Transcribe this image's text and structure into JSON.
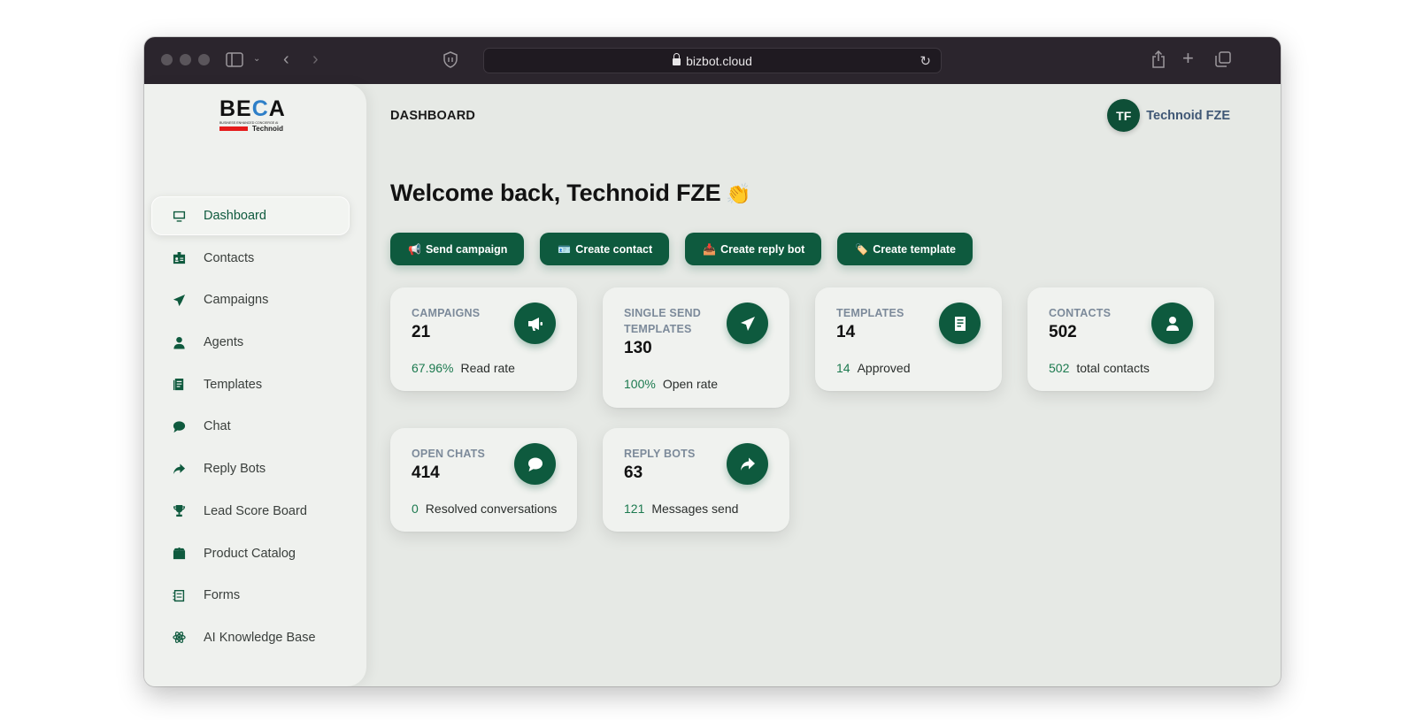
{
  "browser": {
    "url": "bizbot.cloud"
  },
  "logo": {
    "text_main": "BECA",
    "tagline": "BUSINESS ENHANCED CONCIERGE AI",
    "sub": "Technoid"
  },
  "sidebar": {
    "items": [
      {
        "label": "Dashboard",
        "icon": "monitor-icon",
        "active": true
      },
      {
        "label": "Contacts",
        "icon": "contact-card-icon"
      },
      {
        "label": "Campaigns",
        "icon": "paper-plane-icon"
      },
      {
        "label": "Agents",
        "icon": "user-icon"
      },
      {
        "label": "Templates",
        "icon": "document-icon"
      },
      {
        "label": "Chat",
        "icon": "chat-bubble-icon"
      },
      {
        "label": "Reply Bots",
        "icon": "share-arrow-icon"
      },
      {
        "label": "Lead Score Board",
        "icon": "trophy-icon"
      },
      {
        "label": "Product Catalog",
        "icon": "box-icon"
      },
      {
        "label": "Forms",
        "icon": "form-icon"
      },
      {
        "label": "AI Knowledge Base",
        "icon": "atom-icon"
      }
    ]
  },
  "header": {
    "title": "DASHBOARD",
    "user_initials": "TF",
    "user_name": "Technoid FZE"
  },
  "welcome": {
    "text": "Welcome back, Technoid FZE",
    "emoji": "👏"
  },
  "actions": [
    {
      "emoji": "📢",
      "label": "Send campaign"
    },
    {
      "emoji": "🪪",
      "label": "Create contact"
    },
    {
      "emoji": "📥",
      "label": "Create reply bot"
    },
    {
      "emoji": "🏷️",
      "label": "Create template"
    }
  ],
  "cards": [
    {
      "title": "CAMPAIGNS",
      "value": "21",
      "metric": "67.96%",
      "metric_label": "Read rate",
      "icon": "megaphone-icon"
    },
    {
      "title": "SINGLE SEND TEMPLATES",
      "value": "130",
      "metric": "100%",
      "metric_label": "Open rate",
      "icon": "paper-plane-icon"
    },
    {
      "title": "TEMPLATES",
      "value": "14",
      "metric": "14",
      "metric_label": "Approved",
      "icon": "document-icon"
    },
    {
      "title": "CONTACTS",
      "value": "502",
      "metric": "502",
      "metric_label": "total contacts",
      "icon": "user-icon"
    },
    {
      "title": "OPEN CHATS",
      "value": "414",
      "metric": "0",
      "metric_label": "Resolved conversations",
      "icon": "chat-bubble-icon"
    },
    {
      "title": "REPLY BOTS",
      "value": "63",
      "metric": "121",
      "metric_label": "Messages send",
      "icon": "share-arrow-icon"
    }
  ],
  "colors": {
    "accent": "#0e5a3e",
    "metric": "#1c7a4f",
    "card_title": "#7c8a9a"
  }
}
